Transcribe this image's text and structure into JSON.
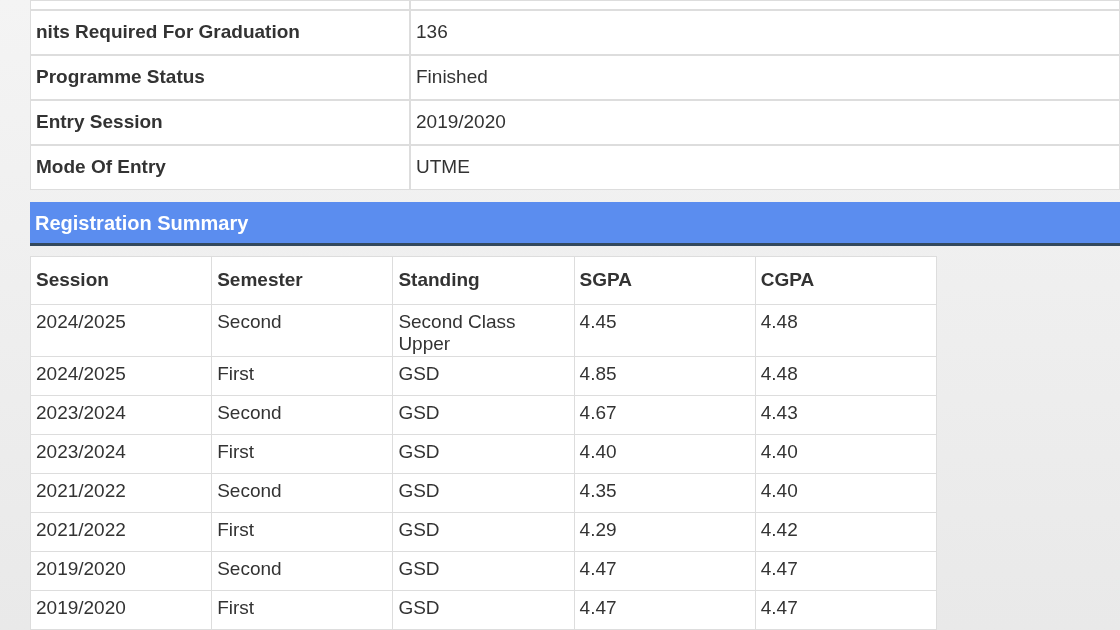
{
  "student_info": [
    {
      "label": "nits Required For Graduation",
      "value": "136"
    },
    {
      "label": "Programme Status",
      "value": "Finished"
    },
    {
      "label": "Entry Session",
      "value": "2019/2020"
    },
    {
      "label": "Mode Of Entry",
      "value": "UTME"
    }
  ],
  "section_title": "Registration Summary",
  "table": {
    "columns": [
      "Session",
      "Semester",
      "Standing",
      "SGPA",
      "CGPA"
    ],
    "rows": [
      [
        "2024/2025",
        "Second",
        "Second Class Upper",
        "4.45",
        "4.48"
      ],
      [
        "2024/2025",
        "First",
        "GSD",
        "4.85",
        "4.48"
      ],
      [
        "2023/2024",
        "Second",
        "GSD",
        "4.67",
        "4.43"
      ],
      [
        "2023/2024",
        "First",
        "GSD",
        "4.40",
        "4.40"
      ],
      [
        "2021/2022",
        "Second",
        "GSD",
        "4.35",
        "4.40"
      ],
      [
        "2021/2022",
        "First",
        "GSD",
        "4.29",
        "4.42"
      ],
      [
        "2019/2020",
        "Second",
        "GSD",
        "4.47",
        "4.47"
      ],
      [
        "2019/2020",
        "First",
        "GSD",
        "4.47",
        "4.47"
      ]
    ]
  }
}
